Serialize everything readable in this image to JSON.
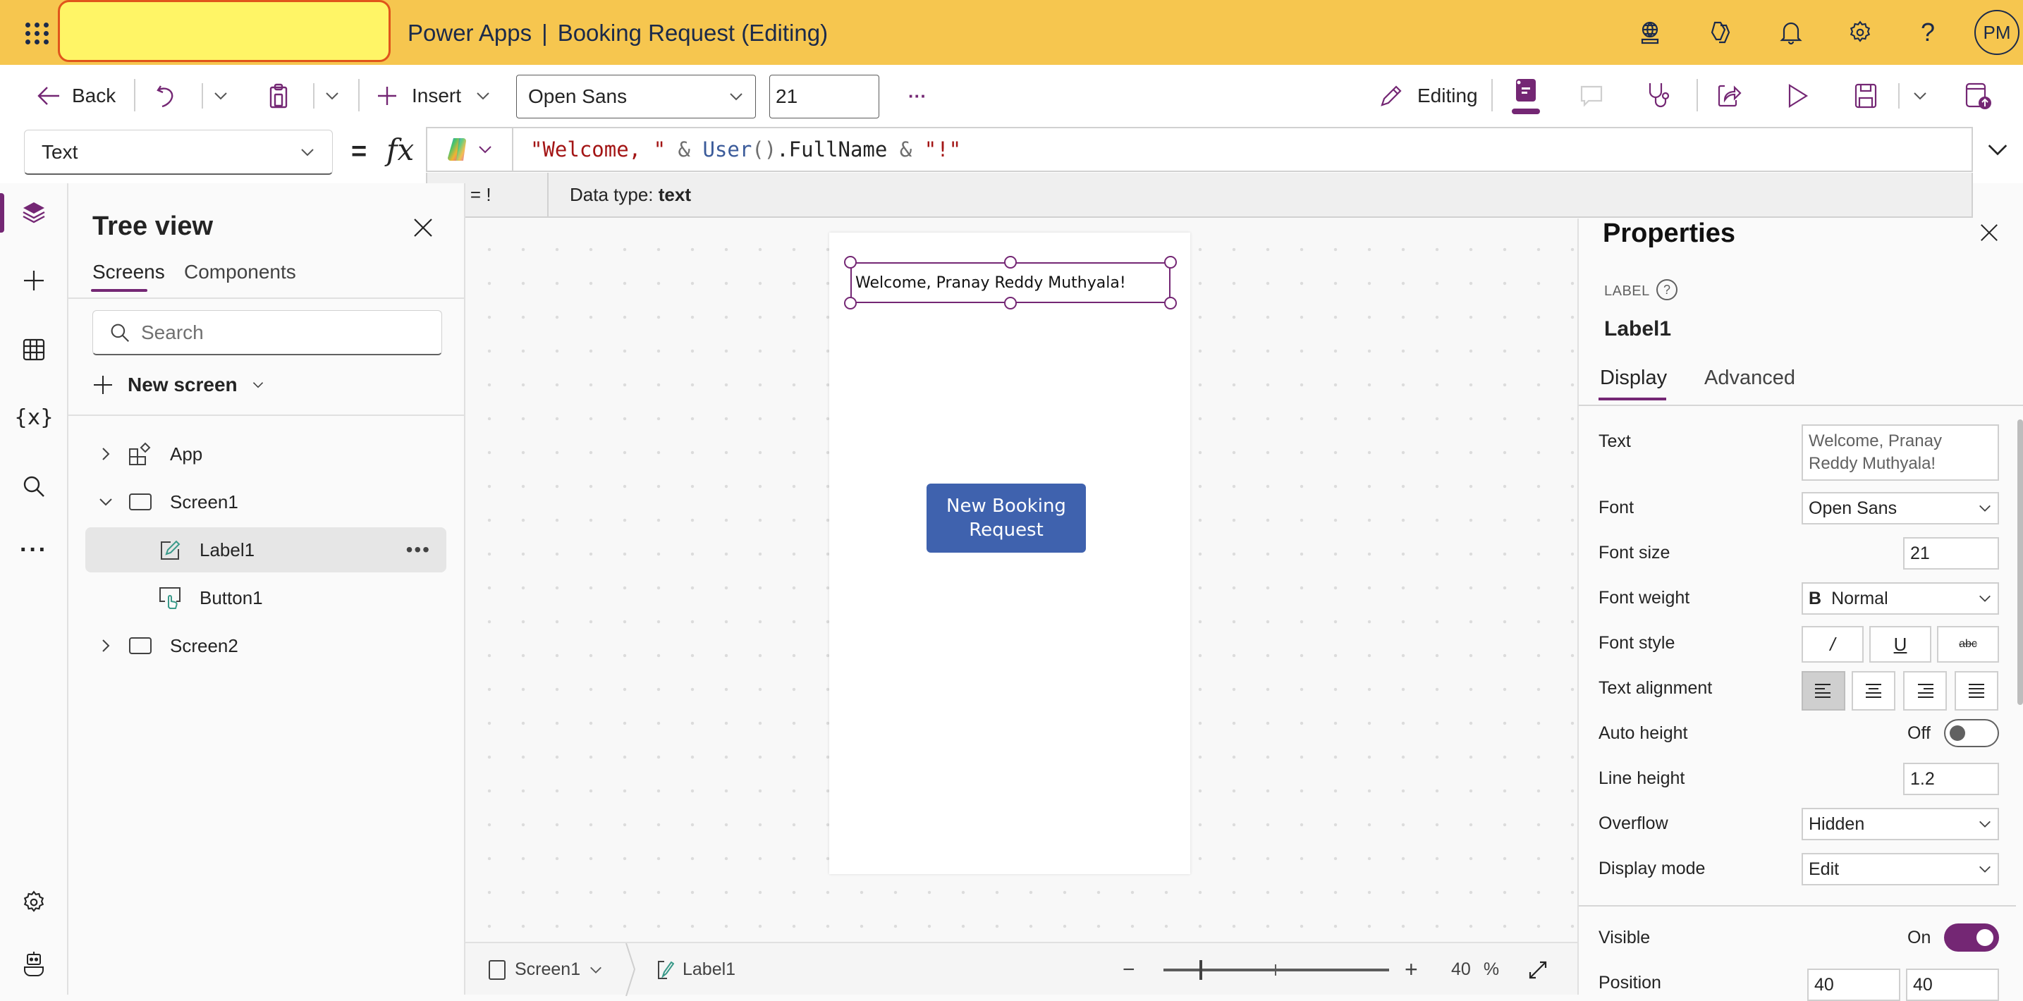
{
  "colors": {
    "topbar_bg": "#f6c64f",
    "accent": "#742774",
    "button_bg": "#3f62ae",
    "formula_string": "#a31515",
    "formula_function": "#3b5b9a"
  },
  "topbar": {
    "app_name": "Power Apps",
    "separator": "|",
    "doc_title": "Booking Request (Editing)",
    "avatar_initials": "PM",
    "icons": [
      "environment-globe-icon",
      "copilot-icon",
      "notifications-bell-icon",
      "settings-gear-icon",
      "help-question-icon"
    ]
  },
  "toolbar": {
    "back_label": "Back",
    "insert_label": "Insert",
    "font_value": "Open Sans",
    "font_size_value": "21",
    "more_label": "···",
    "editing_label": "Editing"
  },
  "formula_bar": {
    "property": "Text",
    "equals": "=",
    "fx": "fx",
    "formula_tokens": [
      {
        "text": "\"Welcome, \"",
        "kind": "string"
      },
      {
        "text": " & ",
        "kind": "operator"
      },
      {
        "text": "User",
        "kind": "function"
      },
      {
        "text": "()",
        "kind": "operator"
      },
      {
        "text": ".FullName",
        "kind": "identifier"
      },
      {
        "text": " & ",
        "kind": "operator"
      },
      {
        "text": "\"!\"",
        "kind": "string"
      }
    ],
    "hint_eval": "\"!\"  =  !",
    "hint_type_prefix": "Data type: ",
    "hint_type_value": "text"
  },
  "tree_view": {
    "title": "Tree view",
    "tabs": [
      "Screens",
      "Components"
    ],
    "active_tab": "Screens",
    "search_placeholder": "Search",
    "new_screen_label": "New screen",
    "items": [
      {
        "label": "App",
        "level": 0,
        "expander": "collapsed",
        "icon": "app-icon"
      },
      {
        "label": "Screen1",
        "level": 0,
        "expander": "expanded",
        "icon": "screen-icon"
      },
      {
        "label": "Label1",
        "level": 1,
        "expander": "none",
        "icon": "label-edit-icon",
        "selected": true
      },
      {
        "label": "Button1",
        "level": 1,
        "expander": "none",
        "icon": "button-icon"
      },
      {
        "label": "Screen2",
        "level": 0,
        "expander": "collapsed",
        "icon": "screen-icon"
      }
    ]
  },
  "canvas": {
    "label_text": "Welcome, Pranay Reddy Muthyala!",
    "button_text": "New Booking Request"
  },
  "statusbar": {
    "screen_crumb": "Screen1",
    "control_crumb": "Label1",
    "zoom_minus": "−",
    "zoom_plus": "+",
    "zoom_value": "40",
    "zoom_unit": "%",
    "zoom_percent": 40
  },
  "properties": {
    "title": "Properties",
    "control_type": "LABEL",
    "control_name": "Label1",
    "tabs": [
      "Display",
      "Advanced"
    ],
    "active_tab": "Display",
    "text_label": "Text",
    "text_value": "Welcome, Pranay Reddy Muthyala!",
    "font_label": "Font",
    "font_value": "Open Sans",
    "font_size_label": "Font size",
    "font_size_value": "21",
    "font_weight_label": "Font weight",
    "font_weight_glyph": "B",
    "font_weight_value": "Normal",
    "font_style_label": "Font style",
    "font_style_buttons": [
      "/",
      "U",
      "abc"
    ],
    "text_alignment_label": "Text alignment",
    "text_alignment_options": [
      "left",
      "center",
      "right",
      "justify"
    ],
    "text_alignment_selected": "left",
    "auto_height_label": "Auto height",
    "auto_height_state": "Off",
    "line_height_label": "Line height",
    "line_height_value": "1.2",
    "overflow_label": "Overflow",
    "overflow_value": "Hidden",
    "display_mode_label": "Display mode",
    "display_mode_value": "Edit",
    "visible_label": "Visible",
    "visible_state": "On",
    "position_label": "Position",
    "position_x": "40",
    "position_y": "40"
  }
}
